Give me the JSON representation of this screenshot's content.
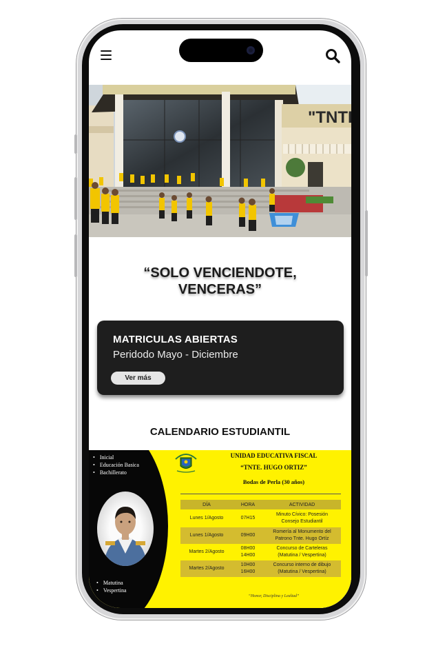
{
  "header": {
    "menu_icon": "hamburger-menu-icon",
    "search_icon": "search-icon"
  },
  "hero": {
    "building_sign": "\"TNTE"
  },
  "motto": {
    "line1": "“SOLO VENCIENDOTE,",
    "line2": "VENCERAS”"
  },
  "enrollment": {
    "title": "MATRICULAS ABIERTAS",
    "subtitle": "Peridodo Mayo - Diciembre",
    "button_label": "Ver más",
    "card_color": "#1e1e1e"
  },
  "calendar": {
    "title": "CALENDARIO ESTUDIANTIL",
    "poster": {
      "levels": [
        "Inicial",
        "Educación Basica",
        "Bachillerato"
      ],
      "shifts": [
        "Matutina",
        "Vespertina"
      ],
      "heading": "UNIDAD EDUCATIVA FISCAL",
      "school": "“TNTE. HUGO ORTIZ”",
      "anniversary": "Bodas de Perla (30 años)",
      "table_headers": [
        "DÍA",
        "HORA",
        "ACTIVIDAD"
      ],
      "rows": [
        {
          "day": "Lunes 1/Agosto",
          "time": [
            "07H15"
          ],
          "activity": [
            "Minuto Cívico: Posesión",
            "Consejo Estudiantil"
          ]
        },
        {
          "day": "Lunes 1/Agosto",
          "time": [
            "09H00"
          ],
          "activity": [
            "Romería al Monumento del",
            "Patrono Tnte. Hugo Ortíz"
          ]
        },
        {
          "day": "Martes 2/Agosto",
          "time": [
            "08H00",
            "14H00"
          ],
          "activity": [
            "Concurso de Carteleras",
            "(Matutina / Vespertina)"
          ]
        },
        {
          "day": "Martes 2/Agosto",
          "time": [
            "10H00",
            "16H00"
          ],
          "activity": [
            "Concurso interno de dibujo",
            "(Matutina / Vespertina)"
          ]
        }
      ],
      "footer": "“Honor, Disciplina y Lealtad”",
      "accent_yellow": "#fff200",
      "row_shade": "#d4bc2f"
    }
  }
}
